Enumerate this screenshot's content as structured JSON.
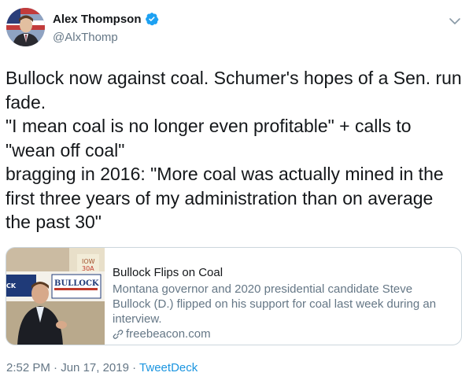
{
  "author": {
    "display_name": "Alex Thompson",
    "handle": "@AlxThomp",
    "verified": true
  },
  "tweet": {
    "text": "Bullock now against coal. Schumer's hopes of a Sen. run\nfade.\n\"I mean coal is no longer even profitable\" + calls to\n\"wean off coal\"\nbragging in 2016: \"More coal was actually mined in the\nfirst three years of my administration than on average\nthe past 30\""
  },
  "card": {
    "title": "Bullock Flips on Coal",
    "description": "Montana governor and 2020 presidential candidate Steve Bullock (D.) flipped on his support for coal last week during an interview.",
    "domain": "freebeacon.com",
    "image_sign_text": "BULLOCK"
  },
  "meta": {
    "time": "2:52 PM",
    "separator": "·",
    "date": "Jun 17, 2019",
    "source": "TweetDeck"
  },
  "colors": {
    "accent": "#1b95e0",
    "text": "#14171a",
    "muted": "#657786",
    "border": "#ccd6dd"
  },
  "icons": {
    "verified": "verified-badge-icon",
    "caret": "chevron-down-icon",
    "link": "link-icon"
  }
}
